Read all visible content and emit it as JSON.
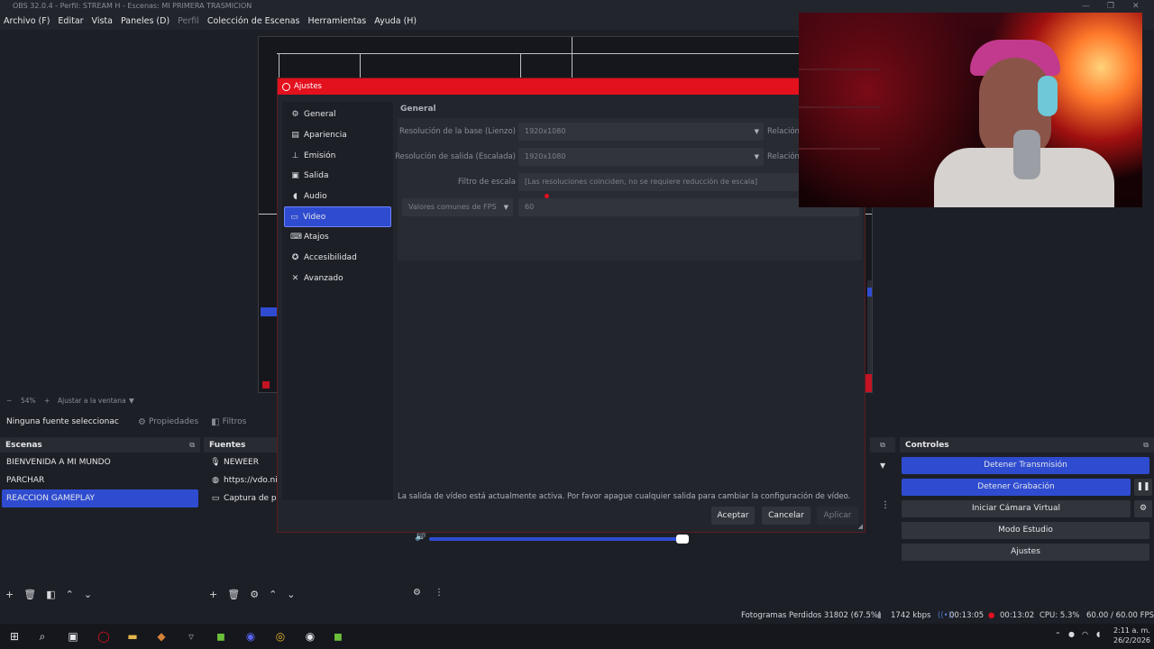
{
  "window": {
    "title": "OBS 32.0.4 - Perfil: STREAM H - Escenas: MI PRIMERA TRASMICION"
  },
  "menu": [
    "Archivo (F)",
    "Editar",
    "Vista",
    "Paneles (D)",
    "Perfil",
    "Colección de Escenas",
    "Herramientas",
    "Ayuda (H)"
  ],
  "zoom": {
    "minus": "−",
    "value": "54%",
    "plus": "+",
    "fit": "Ajustar a la ventana"
  },
  "propbar": {
    "no_source": "Ninguna fuente seleccionac",
    "properties": "Propiedades",
    "filters": "Filtros"
  },
  "scenes": {
    "title": "Escenas",
    "items": [
      "BIENVENIDA A MI MUNDO",
      "PARCHAR",
      "REACCION GAMEPLAY"
    ],
    "selected": 2
  },
  "sources": {
    "title": "Fuentes",
    "items": [
      {
        "icon": "mic-icon",
        "label": "NEWEER"
      },
      {
        "icon": "globe-icon",
        "label": "https://vdo.nin"
      },
      {
        "icon": "monitor-icon",
        "label": "Captura de par"
      }
    ]
  },
  "controls": {
    "title": "Controles",
    "stop_stream": "Detener Transmisión",
    "stop_record": "Detener Grabación",
    "virtual_cam": "Iniciar Cámara Virtual",
    "studio_mode": "Modo Estudio",
    "settings": "Ajustes"
  },
  "settings_dialog": {
    "title": "Ajustes",
    "nav": [
      {
        "icon": "gear-icon",
        "label": "General"
      },
      {
        "icon": "appearance-icon",
        "label": "Apariencia"
      },
      {
        "icon": "broadcast-icon",
        "label": "Emisión"
      },
      {
        "icon": "output-icon",
        "label": "Salida"
      },
      {
        "icon": "audio-icon",
        "label": "Audio"
      },
      {
        "icon": "video-icon",
        "label": "Video"
      },
      {
        "icon": "keyboard-icon",
        "label": "Atajos"
      },
      {
        "icon": "accessibility-icon",
        "label": "Accesibilidad"
      },
      {
        "icon": "advanced-icon",
        "label": "Avanzado"
      }
    ],
    "selected_nav": 5,
    "section": "General",
    "base_res_label": "Resolución de la base (Lienzo)",
    "base_res_value": "1920x1080",
    "output_res_label": "Resolución de salida (Escalada)",
    "output_res_value": "1920x1080",
    "ratio_label": "Relación",
    "scale_filter_label": "Filtro de escala",
    "scale_filter_value": "[Las resoluciones coinciden, no se requiere reducción de escala]",
    "fps_type": "Valores comunes de FPS",
    "fps_value": "60",
    "warning": "La salida de vídeo está actualmente activa. Por favor apague cualquier salida para cambiar la configuración de vídeo.",
    "ok": "Aceptar",
    "cancel": "Cancelar",
    "apply": "Aplicar"
  },
  "statusbar": {
    "dropped": "Fotogramas Perdidos 31802 (67.5%)",
    "bitrate": "1742 kbps",
    "stream_time": "00:13:05",
    "rec_time": "00:13:02",
    "cpu": "CPU: 5.3%",
    "fps": "60.00 / 60.00 FPS"
  },
  "taskbar": {
    "time": "2:11 a. m.",
    "date": "26/2/2026"
  },
  "colors": {
    "accent": "#2f4cd0",
    "dialog_title": "#e3101e",
    "panel": "#292b33"
  }
}
